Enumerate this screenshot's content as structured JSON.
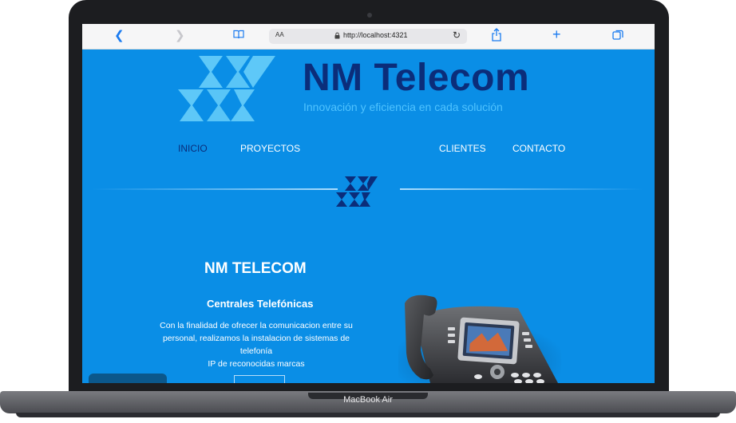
{
  "browser": {
    "aa_label": "AA",
    "url": "http://localhost:4321",
    "back_icon": "chevron-left-icon",
    "forward_icon": "chevron-right-icon",
    "reader_icon": "book-icon",
    "reload_icon": "reload-icon",
    "share_icon": "share-icon",
    "new_tab_icon": "plus-icon",
    "tabs_icon": "tabs-icon"
  },
  "header": {
    "title": "NM Telecom",
    "tagline": "Innovación y eficiencia en cada solución"
  },
  "nav": {
    "items": [
      {
        "label": "INICIO",
        "active": true
      },
      {
        "label": "PROYECTOS",
        "active": false
      },
      {
        "label": "CLIENTES",
        "active": false
      },
      {
        "label": "CONTACTO",
        "active": false
      }
    ]
  },
  "section": {
    "title": "NM TELECOM",
    "subtitle": "Centrales Telefónicas",
    "description_lines": [
      "Con la finalidad de ofrecer la comunicacion entre su",
      "personal, realizamos la instalacion de sistemas de telefonía",
      "IP de reconocidas marcas"
    ]
  },
  "device": {
    "label": "MacBook Air"
  },
  "colors": {
    "page_bg": "#0a8ee6",
    "brand_dark": "#0b2d7a",
    "brand_light": "#4fc3ff",
    "logo_light": "#5ec8f8"
  }
}
